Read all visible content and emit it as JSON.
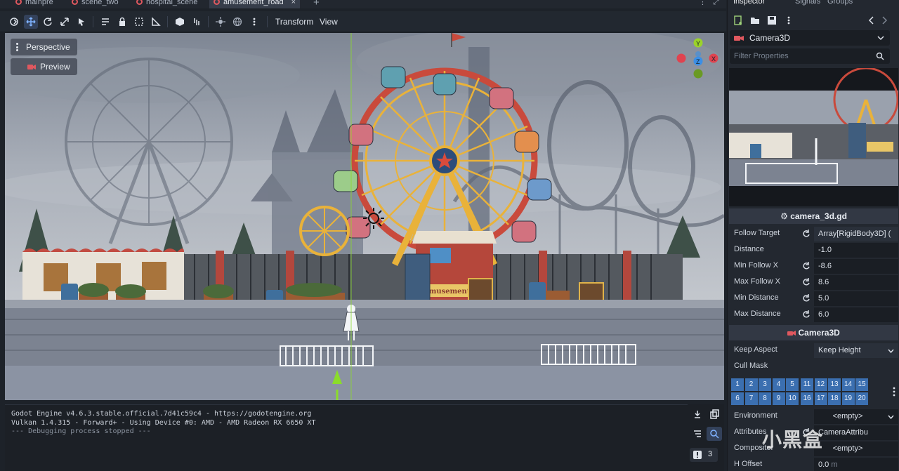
{
  "tabs": [
    {
      "label": "mainpre",
      "active": false
    },
    {
      "label": "scene_two",
      "active": false
    },
    {
      "label": "hospital_scene",
      "active": false
    },
    {
      "label": "amusement_road",
      "active": true
    }
  ],
  "toolbar": {
    "transform_label": "Transform",
    "view_label": "View"
  },
  "viewport": {
    "perspective_label": "Perspective",
    "preview_label": "Preview",
    "sign_text": "Amusement Park",
    "gizmo_axes": {
      "y": "Y",
      "z": "Z",
      "x": "X"
    }
  },
  "output": {
    "lines": [
      "Godot Engine v4.6.3.stable.official.7d41c59c4 - https://godotengine.org",
      "Vulkan 1.4.315 - Forward+ - Using Device #0: AMD - AMD Radeon RX 6650 XT",
      "",
      "--- Debugging process stopped ---"
    ],
    "error_count": "3"
  },
  "inspector": {
    "tabs": [
      "Inspector",
      "Signals",
      "Groups"
    ],
    "node_name": "Camera3D",
    "filter_placeholder": "Filter Properties",
    "script_header": "camera_3d.gd",
    "script_props": [
      {
        "name": "Follow Target",
        "value": "Array[RigidBody3D] (",
        "revert": true
      },
      {
        "name": "Distance",
        "value": "-1.0",
        "revert": false
      },
      {
        "name": "Min Follow X",
        "value": "-8.6",
        "revert": true
      },
      {
        "name": "Max Follow X",
        "value": "8.6",
        "revert": true
      },
      {
        "name": "Min Distance",
        "value": "5.0",
        "revert": true
      },
      {
        "name": "Max Distance",
        "value": "6.0",
        "revert": true
      }
    ],
    "camera_header": "Camera3D",
    "keep_aspect": {
      "name": "Keep Aspect",
      "value": "Keep Height"
    },
    "cull_mask_label": "Cull Mask",
    "cull_mask_layers": [
      "1",
      "2",
      "3",
      "4",
      "5",
      "11",
      "12",
      "13",
      "14",
      "15",
      "6",
      "7",
      "8",
      "9",
      "10",
      "16",
      "17",
      "18",
      "19",
      "20"
    ],
    "more_props": [
      {
        "name": "Environment",
        "value": "<empty>"
      },
      {
        "name": "Attributes",
        "value": "CameraAttribu"
      },
      {
        "name": "Compositor",
        "value": "<empty>"
      },
      {
        "name": "H Offset",
        "value": "0.0",
        "unit": "m"
      }
    ]
  },
  "watermark": "小黑盒",
  "colors": {
    "accent": "#3b6fb0",
    "tab_dot": "#e0585f",
    "gizmo_x": "#e0434f",
    "gizmo_y": "#9bd32a",
    "gizmo_z": "#3b8fe6"
  }
}
